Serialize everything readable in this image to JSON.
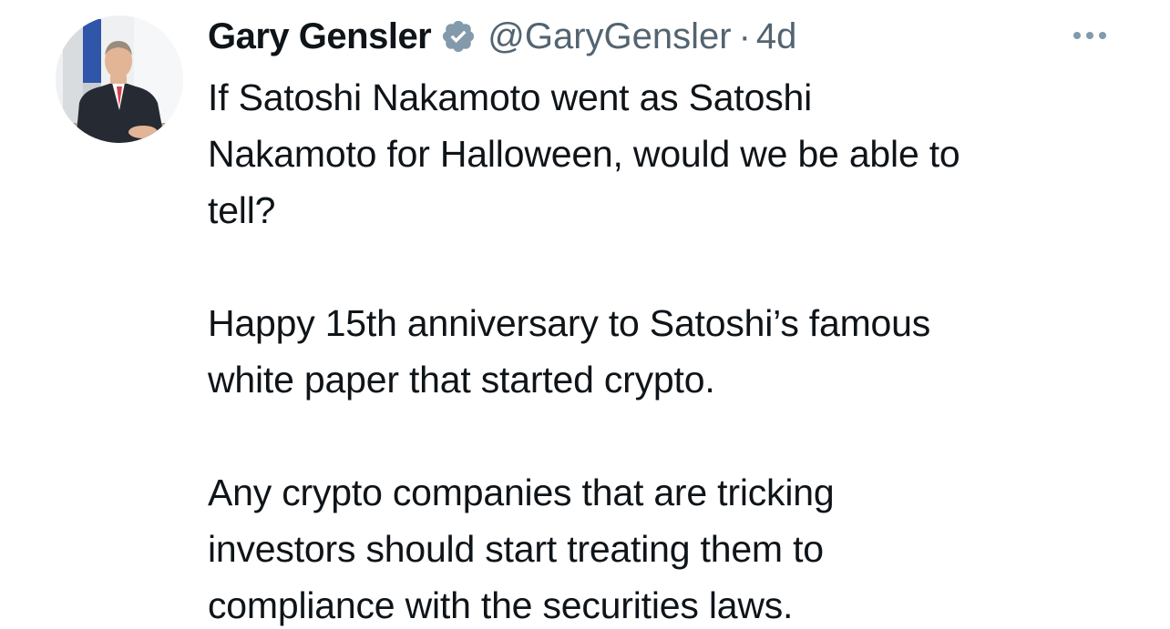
{
  "tweet": {
    "author": {
      "display_name": "Gary Gensler",
      "handle": "@GaryGensler",
      "verified_icon": "verified-badge-icon"
    },
    "separator": "·",
    "timestamp": "4d",
    "more_icon": "more-options-icon",
    "text": {
      "line_1": "If Satoshi Nakamoto went as Satoshi",
      "line_2": "Nakamoto for Halloween, would we be able to",
      "line_3": "tell?",
      "line_4": "Happy 15th anniversary to Satoshi’s famous",
      "line_5": "white paper that started crypto.",
      "line_6": "Any crypto companies that are tricking",
      "line_7": "investors should start treating them to",
      "line_8": "compliance with the securities laws."
    }
  },
  "colors": {
    "text_primary": "#0f1419",
    "text_secondary": "#536471",
    "verified_badge": "#829aab",
    "background": "#ffffff"
  }
}
